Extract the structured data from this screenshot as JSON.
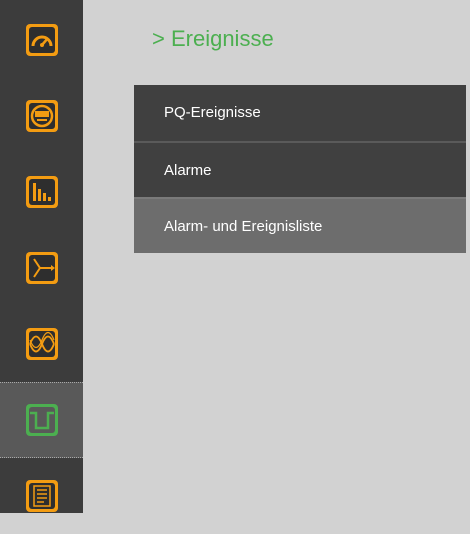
{
  "page": {
    "breadcrumb": "> Ereignisse"
  },
  "sidebar": {
    "items": [
      {
        "icon": "gauge-icon",
        "color": "#f39c12",
        "active": false
      },
      {
        "icon": "meter-display-icon",
        "color": "#f39c12",
        "active": false
      },
      {
        "icon": "bar-chart-icon",
        "color": "#f39c12",
        "active": false
      },
      {
        "icon": "phasor-diagram-icon",
        "color": "#f39c12",
        "active": false
      },
      {
        "icon": "waveform-icon",
        "color": "#f39c12",
        "active": false
      },
      {
        "icon": "event-pulse-icon",
        "color": "#4caf50",
        "active": true
      },
      {
        "icon": "list-document-icon",
        "color": "#f39c12",
        "active": false
      }
    ]
  },
  "menu": {
    "items": [
      {
        "label": "PQ-Ereignisse",
        "selected": false
      },
      {
        "label": "Alarme",
        "selected": false
      },
      {
        "label": "Alarm- und Ereignisliste",
        "selected": true
      }
    ]
  },
  "colors": {
    "accent_orange": "#f39c12",
    "accent_green": "#4caf50",
    "sidebar_bg": "#3c3c3c",
    "menu_bg": "#404040",
    "menu_selected_bg": "#6d6d6d"
  }
}
